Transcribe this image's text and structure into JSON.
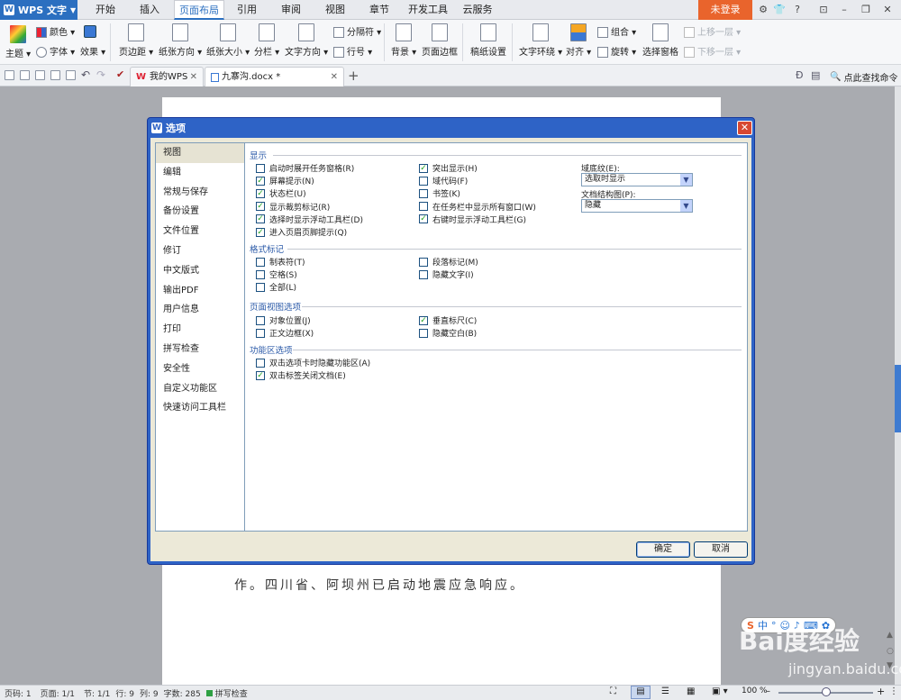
{
  "app": {
    "title": "WPS 文字",
    "login": "未登录"
  },
  "menu": {
    "tabs": [
      "开始",
      "插入",
      "页面布局",
      "引用",
      "审阅",
      "视图",
      "章节",
      "开发工具",
      "云服务"
    ],
    "active": 2
  },
  "ribbon": {
    "theme": "主题",
    "color": "颜色",
    "font": "字体",
    "effect": "效果",
    "margin": "页边距",
    "orientation": "纸张方向",
    "size": "纸张大小",
    "columns": "分栏",
    "text_dir": "文字方向",
    "separator": "分隔符",
    "line_no": "行号",
    "background": "背景",
    "page_border": "页面边框",
    "draft": "稿纸设置",
    "wrap": "文字环绕",
    "align": "对齐",
    "group": "组合",
    "rotate": "旋转",
    "select_pane": "选择窗格",
    "bring_fwd": "上移一层",
    "send_back": "下移一层"
  },
  "tabbar": {
    "tabs": [
      "我的WPS",
      "九寨沟.docx *"
    ],
    "search": "点此查找命令"
  },
  "document": {
    "text": "作。四川省、阿坝州已启动地震应急响应。"
  },
  "dialog": {
    "title": "选项",
    "categories": [
      "视图",
      "编辑",
      "常规与保存",
      "备份设置",
      "文件位置",
      "修订",
      "中文版式",
      "输出PDF",
      "用户信息",
      "打印",
      "拼写检查",
      "安全性",
      "自定义功能区",
      "快速访问工具栏"
    ],
    "selected": 0,
    "display": {
      "label": "显示",
      "left": [
        {
          "label": "启动时展开任务窗格(R)",
          "checked": false
        },
        {
          "label": "屏幕提示(N)",
          "checked": true
        },
        {
          "label": "状态栏(U)",
          "checked": true
        },
        {
          "label": "显示裁剪标记(R)",
          "checked": true
        },
        {
          "label": "选择时显示浮动工具栏(D)",
          "checked": true
        },
        {
          "label": "进入页眉页脚提示(Q)",
          "checked": true
        }
      ],
      "right": [
        {
          "label": "突出显示(H)",
          "checked": true
        },
        {
          "label": "域代码(F)",
          "checked": false
        },
        {
          "label": "书签(K)",
          "checked": false
        },
        {
          "label": "在任务栏中显示所有窗口(W)",
          "checked": false
        },
        {
          "label": "右键时显示浮动工具栏(G)",
          "checked": true
        }
      ],
      "field_shading_label": "域底纹(E):",
      "field_shading_value": "选取时显示",
      "doc_map_label": "文档结构图(P):",
      "doc_map_value": "隐藏"
    },
    "format_marks": {
      "label": "格式标记",
      "left": [
        {
          "label": "制表符(T)",
          "checked": false
        },
        {
          "label": "空格(S)",
          "checked": false
        },
        {
          "label": "全部(L)",
          "checked": false
        }
      ],
      "right": [
        {
          "label": "段落标记(M)",
          "checked": false
        },
        {
          "label": "隐藏文字(I)",
          "checked": false
        }
      ]
    },
    "page_view": {
      "label": "页面视图选项",
      "left": [
        {
          "label": "对象位置(J)",
          "checked": false
        },
        {
          "label": "正文边框(X)",
          "checked": false
        }
      ],
      "right": [
        {
          "label": "垂直标尺(C)",
          "checked": true
        },
        {
          "label": "隐藏空白(B)",
          "checked": false
        }
      ]
    },
    "ribbon_opts": {
      "label": "功能区选项",
      "items": [
        {
          "label": "双击选项卡时隐藏功能区(A)",
          "checked": false
        },
        {
          "label": "双击标签关闭文档(E)",
          "checked": true
        }
      ]
    },
    "ok": "确定",
    "cancel": "取消"
  },
  "status": {
    "page_code": "页码: 1",
    "page": "页面: 1/1",
    "section": "节: 1/1",
    "row": "行: 9",
    "col": "列: 9",
    "words": "字数: 285",
    "spell": "拼写检查",
    "zoom": "100 %"
  },
  "watermark": {
    "main": "Bai度经验",
    "sub": "jingyan.baidu.com"
  },
  "colors": {
    "accent": "#2b6fc0",
    "login": "#e9642c",
    "dialog_frame": "#2e63c6",
    "check": "#21a121"
  }
}
